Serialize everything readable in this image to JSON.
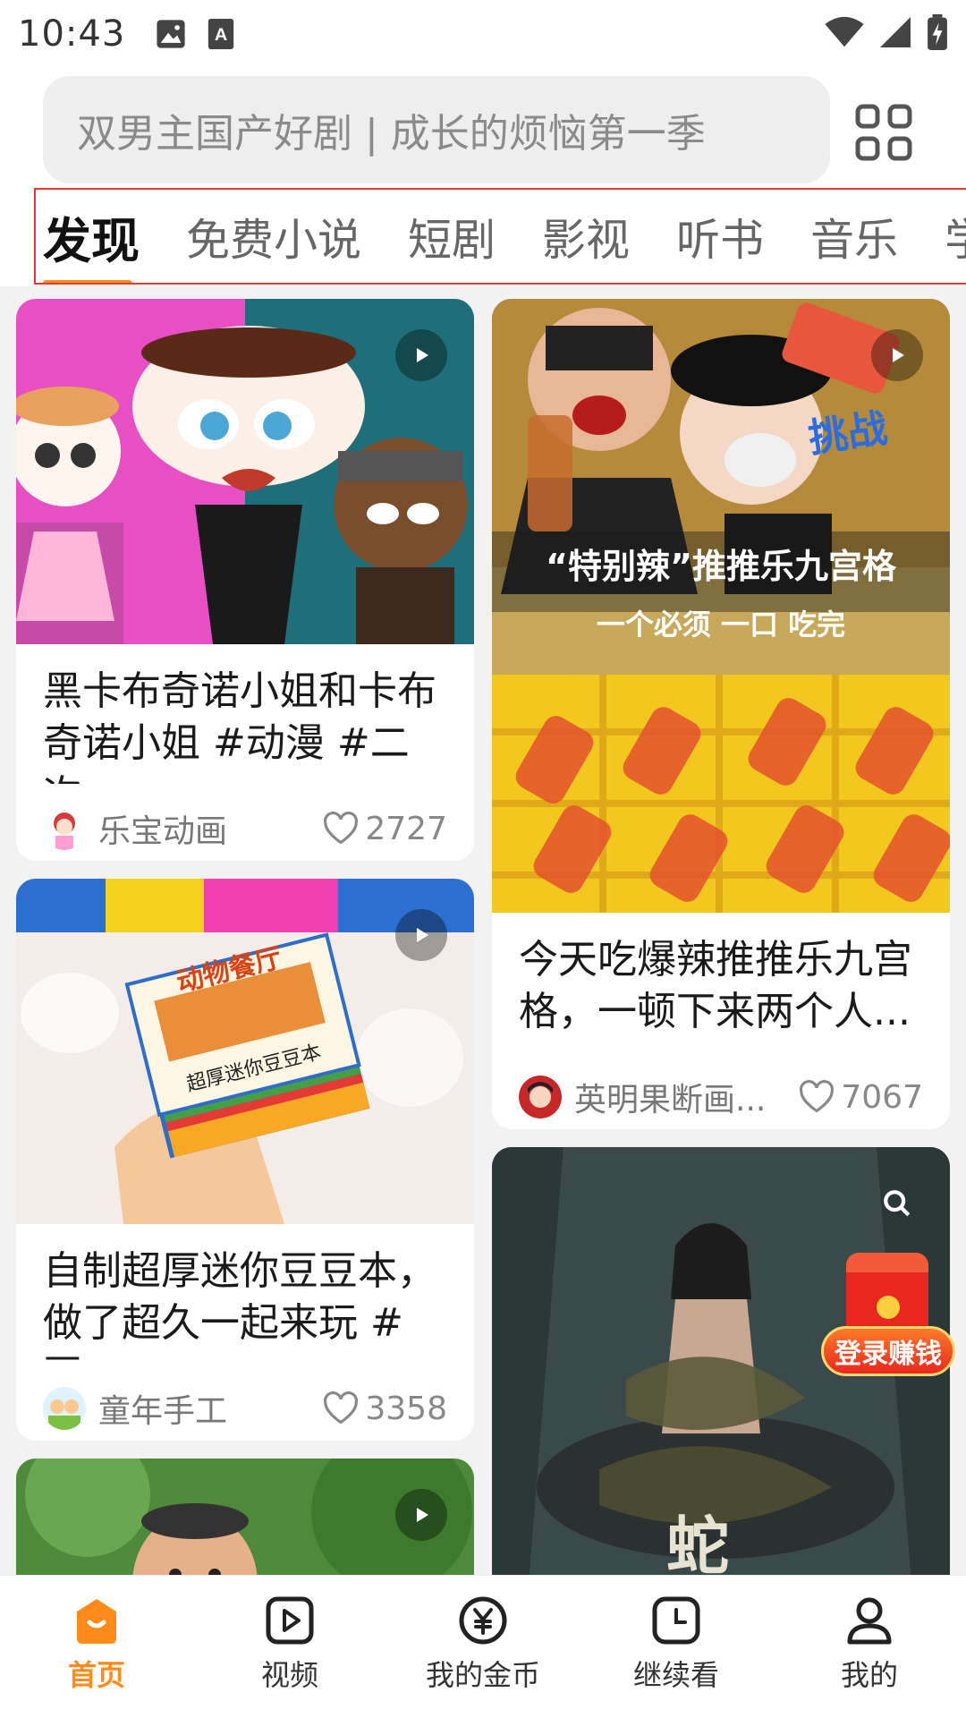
{
  "status_bar": {
    "time": "10:43",
    "icons": [
      "gallery-icon",
      "font-a-icon",
      "wifi-icon",
      "signal-icon",
      "battery-charging-icon"
    ]
  },
  "search": {
    "placeholder": "双男主国产好剧 | 成长的烦恼第一季",
    "grid_icon": "apps-grid-icon"
  },
  "tabs": [
    {
      "label": "发现",
      "active": true
    },
    {
      "label": "免费小说"
    },
    {
      "label": "短剧"
    },
    {
      "label": "影视"
    },
    {
      "label": "听书"
    },
    {
      "label": "音乐"
    },
    {
      "label": "学习"
    }
  ],
  "feed": {
    "left": [
      {
        "title": "黑卡布奇诺小姐和卡布奇诺小姐 #动漫 #二次...",
        "author": "乐宝动画",
        "likes": "2727"
      },
      {
        "title": "自制超厚迷你豆豆本，做了超久一起来玩 #豆...",
        "author": "童年手工",
        "likes": "3358"
      },
      {
        "title": "",
        "author": "",
        "likes": ""
      }
    ],
    "right": [
      {
        "title": "今天吃爆辣推推乐九宫格，一顿下来两个人...",
        "author": "英明果断画...",
        "likes": "7067"
      },
      {
        "title": "",
        "author": "",
        "likes": ""
      }
    ],
    "thumb_texts": {
      "challenge": "挑战",
      "spicy_title": "“特别辣”推推乐九宫格",
      "must_eat": "一个必须 一口 吃完",
      "book_title": "动物餐厅",
      "book_subtitle": "超厚迷你豆豆本",
      "snake_title": "蛇"
    }
  },
  "login_badge": {
    "label": "登录赚钱"
  },
  "bottom_nav": [
    {
      "label": "首页",
      "icon": "home-icon",
      "active": true
    },
    {
      "label": "视频",
      "icon": "video-play-icon"
    },
    {
      "label": "我的金币",
      "icon": "coin-yuan-icon"
    },
    {
      "label": "继续看",
      "icon": "clock-icon"
    },
    {
      "label": "我的",
      "icon": "profile-icon"
    }
  ],
  "colors": {
    "accent": "#ff8c1a",
    "tab_highlight_border": "#e53935",
    "background": "#f2f2f2"
  }
}
